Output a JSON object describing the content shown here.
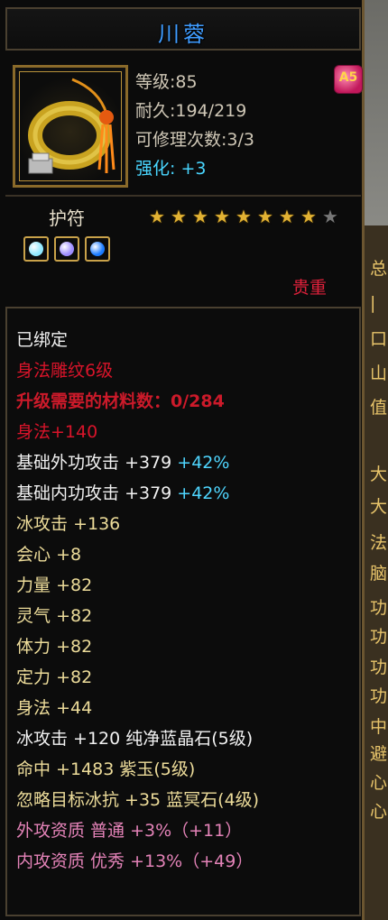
{
  "item": {
    "name": "川蓉",
    "stats": [
      {
        "label": "等级",
        "value": ":85"
      },
      {
        "label": "耐久",
        "value": ":194/219"
      },
      {
        "label": "可修理次数",
        "value": ":3/3"
      }
    ],
    "enhance_label": "强化",
    "enhance_value": ": +3",
    "badge": "A5",
    "amulet_label": "护符",
    "stars_filled": 8,
    "stars_total": 9,
    "gems": [
      {
        "icon": "cyan-gem-icon",
        "color": "#8ee8ff"
      },
      {
        "icon": "purple-gem-icon",
        "color": "#9d8cff"
      },
      {
        "icon": "blue-gem-icon",
        "color": "#1a7bff"
      }
    ],
    "quality": "贵重"
  },
  "details": {
    "bound": "已绑定",
    "skill_level": "身法雕纹6级",
    "upgrade_materials": "升级需要的材料数：0/284",
    "skill_bonus": "身法+140",
    "outer_attack": {
      "label": "基础外功攻击",
      "value": "+379",
      "pct": "+42%"
    },
    "inner_attack": {
      "label": "基础内功攻击",
      "value": "+379",
      "pct": "+42%"
    },
    "attrs": [
      {
        "label": "冰攻击",
        "value": "+136"
      },
      {
        "label": "会心",
        "value": "+8"
      },
      {
        "label": "力量",
        "value": "+82"
      },
      {
        "label": "灵气",
        "value": "+82"
      },
      {
        "label": "体力",
        "value": "+82"
      },
      {
        "label": "定力",
        "value": "+82"
      },
      {
        "label": "身法",
        "value": "+44"
      }
    ],
    "gem_lines": [
      "冰攻击 +120 纯净蓝晶石(5级)",
      "命中 +1483 紫玉(5级)",
      "忽略目标冰抗 +35 蓝冥石(4级)"
    ],
    "aptitude": [
      "外攻资质  普通 +3%（+11）",
      "内攻资质  优秀 +13%（+49）"
    ]
  },
  "side_panel": {
    "chars": [
      {
        "t": "总",
        "c": "y"
      },
      {
        "t": "|",
        "c": "y"
      },
      {
        "t": "口",
        "c": "y"
      },
      {
        "t": "山",
        "c": "y"
      },
      {
        "t": "值",
        "c": "y"
      },
      {
        "t": "大",
        "c": "y"
      },
      {
        "t": "大",
        "c": "y"
      },
      {
        "t": "法",
        "c": "y"
      },
      {
        "t": "脑",
        "c": "y"
      },
      {
        "t": "功",
        "c": "y"
      },
      {
        "t": "功",
        "c": "y"
      },
      {
        "t": "功",
        "c": "y"
      },
      {
        "t": "功",
        "c": "y"
      },
      {
        "t": "中",
        "c": "y"
      },
      {
        "t": "避",
        "c": "y"
      },
      {
        "t": "心",
        "c": "y"
      },
      {
        "t": "心",
        "c": "y"
      }
    ]
  }
}
